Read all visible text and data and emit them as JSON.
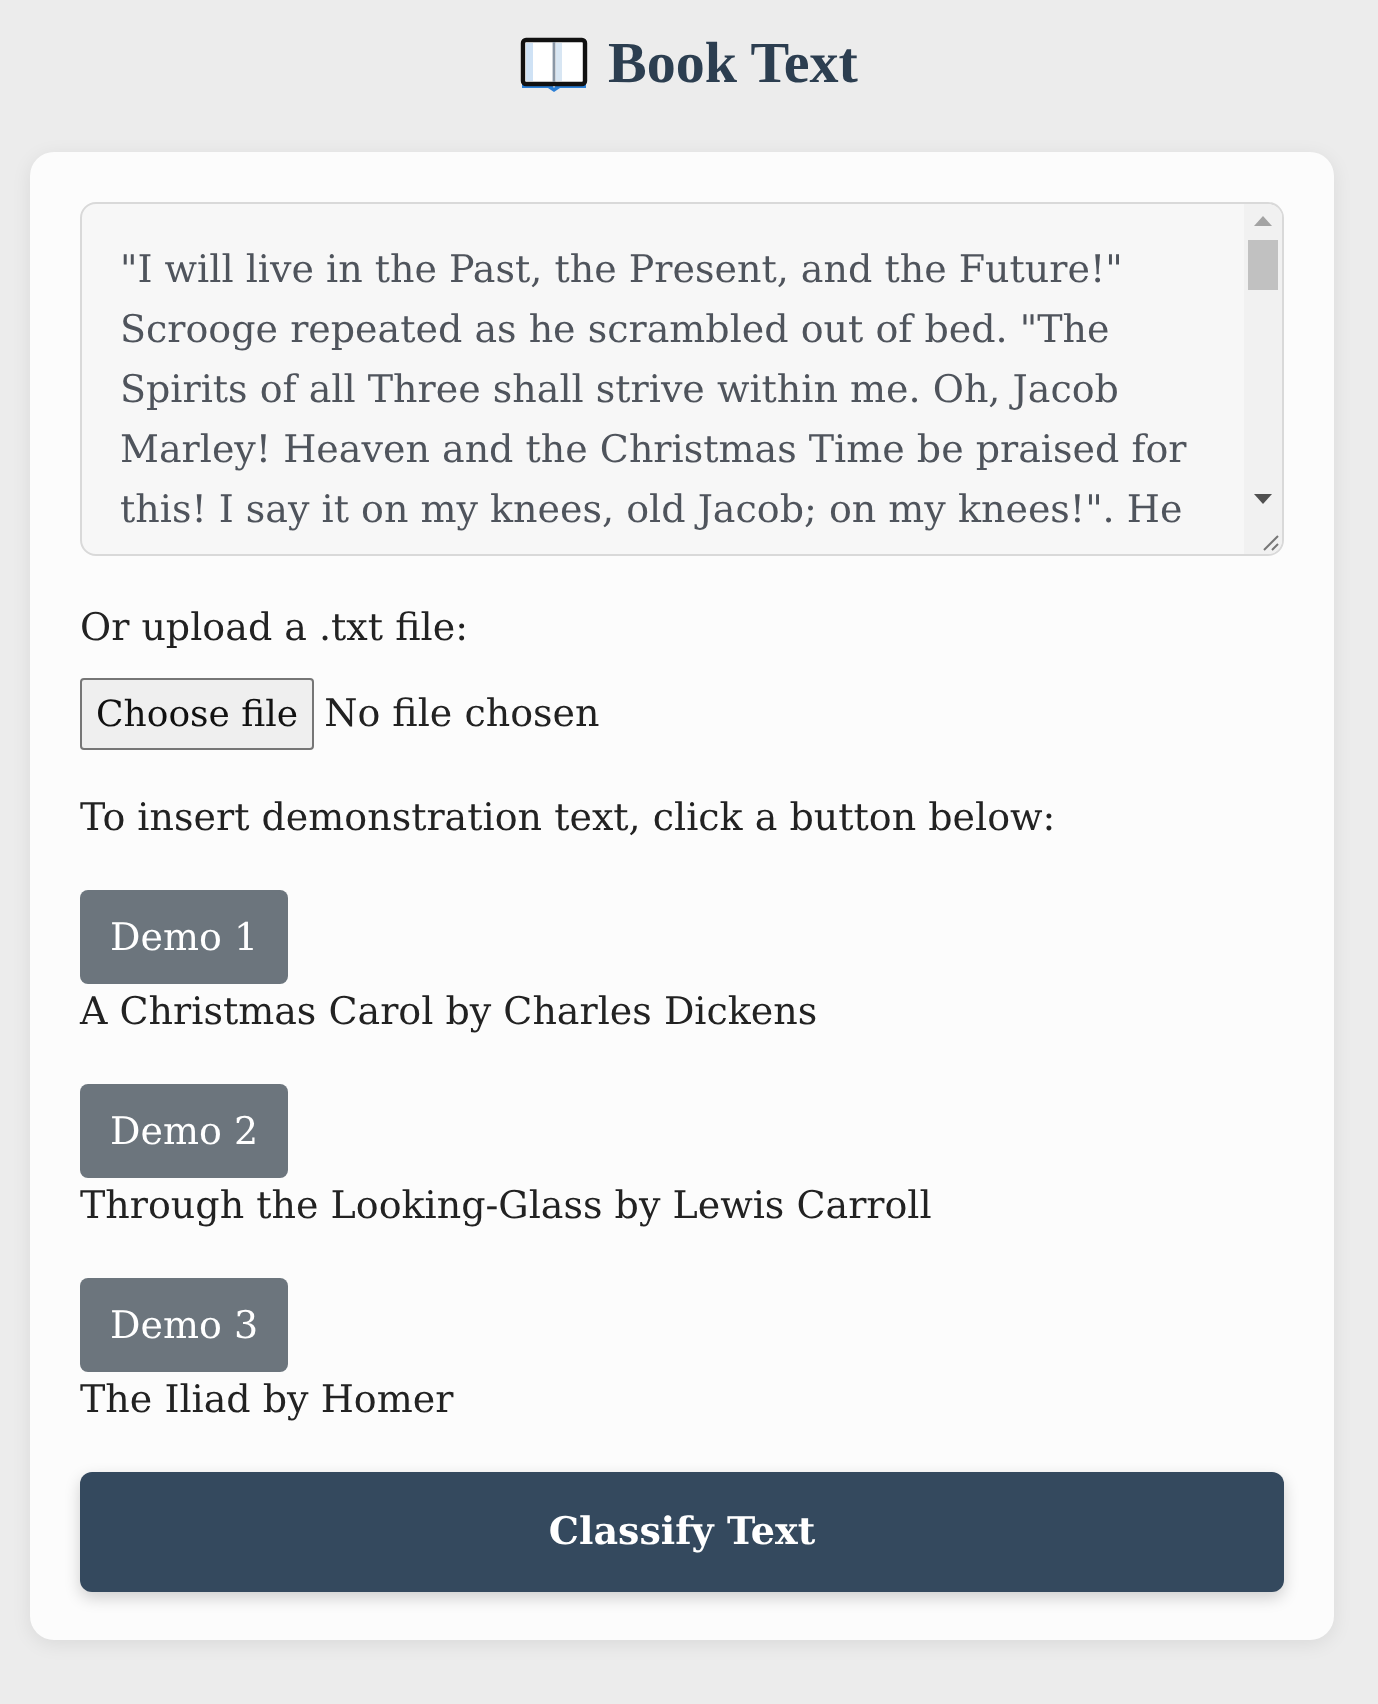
{
  "header": {
    "title": "Book Text"
  },
  "text_input": {
    "value": "\"I will live in the Past, the Present, and the Future!\" Scrooge repeated as he scrambled out of bed. \"The Spirits of all Three shall strive within me. Oh, Jacob Marley! Heaven and the Christmas Time be praised for this! I say it on my knees, old Jacob; on my knees!\". He"
  },
  "upload": {
    "label": "Or upload a .txt file:",
    "button": "Choose file",
    "status": "No file chosen"
  },
  "demo_prompt": "To insert demonstration text, click a button below:",
  "demos": [
    {
      "button": "Demo 1",
      "caption": "A Christmas Carol by Charles Dickens"
    },
    {
      "button": "Demo 2",
      "caption": "Through the Looking-Glass by Lewis Carroll"
    },
    {
      "button": "Demo 3",
      "caption": "The Iliad by Homer"
    }
  ],
  "submit": {
    "label": "Classify Text"
  }
}
